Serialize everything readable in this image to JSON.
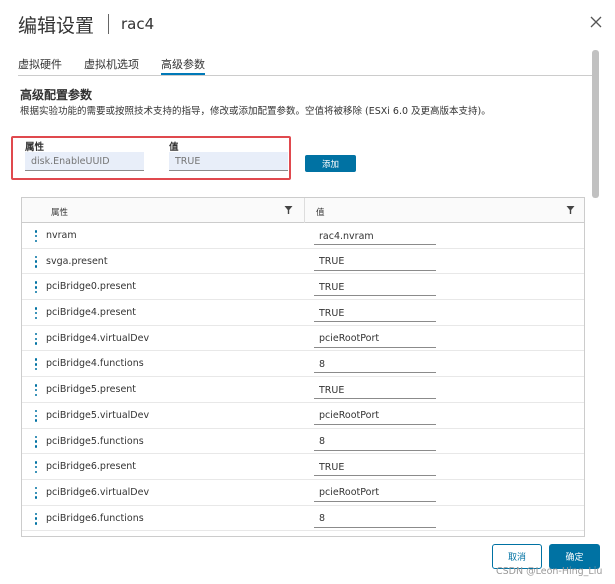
{
  "dialog": {
    "title": "编辑设置",
    "subtitle": "rac4"
  },
  "tabs": [
    {
      "label": "虚拟硬件"
    },
    {
      "label": "虚拟机选项"
    },
    {
      "label": "高级参数"
    }
  ],
  "section": {
    "title": "高级配置参数",
    "description": "根据实验功能的需要或按照技术支持的指导，修改或添加配置参数。空值将被移除 (ESXi 6.0 及更高版本支持)。"
  },
  "add_form": {
    "attr_label": "属性",
    "attr_placeholder": "disk.EnableUUID",
    "value_label": "值",
    "value_placeholder": "TRUE",
    "add_button": "添加"
  },
  "grid": {
    "col_name": "属性",
    "col_value": "值",
    "rows": [
      {
        "name": "nvram",
        "value": "rac4.nvram"
      },
      {
        "name": "svga.present",
        "value": "TRUE"
      },
      {
        "name": "pciBridge0.present",
        "value": "TRUE"
      },
      {
        "name": "pciBridge4.present",
        "value": "TRUE"
      },
      {
        "name": "pciBridge4.virtualDev",
        "value": "pcieRootPort"
      },
      {
        "name": "pciBridge4.functions",
        "value": "8"
      },
      {
        "name": "pciBridge5.present",
        "value": "TRUE"
      },
      {
        "name": "pciBridge5.virtualDev",
        "value": "pcieRootPort"
      },
      {
        "name": "pciBridge5.functions",
        "value": "8"
      },
      {
        "name": "pciBridge6.present",
        "value": "TRUE"
      },
      {
        "name": "pciBridge6.virtualDev",
        "value": "pcieRootPort"
      },
      {
        "name": "pciBridge6.functions",
        "value": "8"
      }
    ]
  },
  "footer": {
    "cancel_label": "取消",
    "ok_label": "确定"
  },
  "watermark": "CSDN @Leon-Hing_Liu",
  "colors": {
    "accent": "#0072a3",
    "highlight_border": "#e0494e",
    "input_background": "#e8eef9"
  }
}
